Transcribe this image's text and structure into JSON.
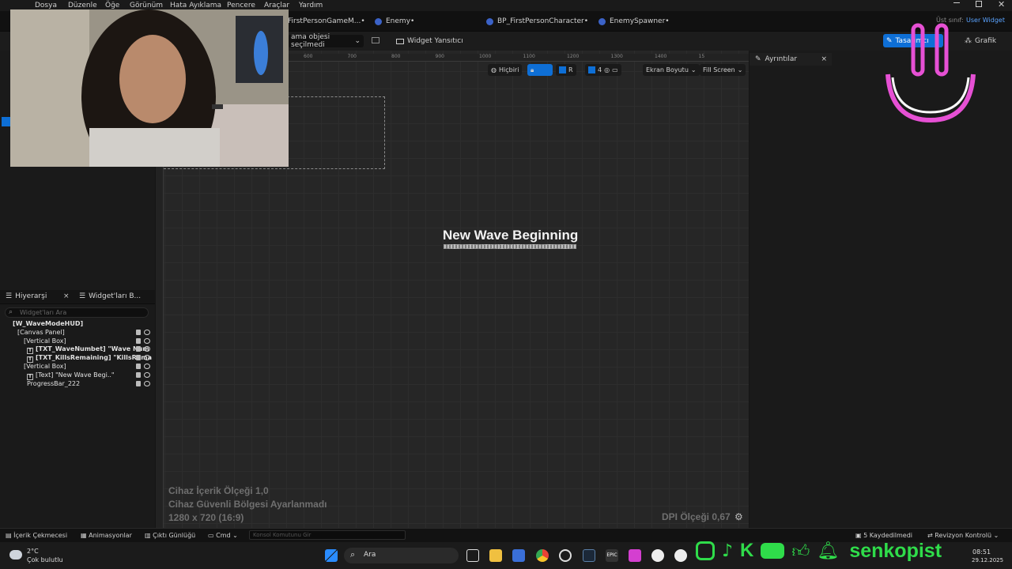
{
  "menubar": {
    "items": [
      "Dosya",
      "Düzenle",
      "Öğe",
      "Görünüm",
      "Hata Ayıklama",
      "Pencere",
      "Araçlar",
      "Yardım"
    ]
  },
  "tabs": {
    "items": [
      "FirstPersonGameM...•",
      "Enemy•",
      "BP_FirstPersonCharacter•",
      "EnemySpawner•"
    ],
    "parent_class_label": "Üst sınıf:",
    "parent_class_value": "User Widget"
  },
  "toolbar": {
    "debug_object": "ama objesi seçilmedi",
    "widget_reflector": "Widget Yansıtıcı",
    "designer_label": "Tasarımcı",
    "graph_label": "Grafik"
  },
  "ruler": {
    "top_ticks": [
      "600",
      "700",
      "800",
      "900",
      "1000",
      "1100",
      "1200",
      "1300",
      "1400",
      "15"
    ]
  },
  "viewport_controls": {
    "none_label": "Hiçbiri",
    "r_label": "R",
    "grid_value": "4",
    "screen_size": "Ekran Boyutu",
    "fill_screen": "Fill Screen"
  },
  "canvas": {
    "wave_text": "New Wave Beginning",
    "progress_percent": 100,
    "info_lines": [
      "Cihaz İçerik Ölçeği 1,0",
      "Cihaz Güvenli Bölgesi Ayarlanmadı",
      "1280 x 720 (16:9)"
    ],
    "dpi_label": "DPI Ölçeği 0,67"
  },
  "hierarchy": {
    "tab_label": "Hiyerarşi",
    "library_tab_label": "Widget'ları B...",
    "search_placeholder": "Widget'ları Ara",
    "rows": [
      {
        "label": "[W_WaveModeHUD]",
        "indent": 0
      },
      {
        "label": "[Canvas Panel]",
        "indent": 1
      },
      {
        "label": "[Vertical Box]",
        "indent": 2
      },
      {
        "label": "[TXT_WaveNumbet] \"Wave Num",
        "indent": 3
      },
      {
        "label": "[TXT_KillsRemaining] \"KillsRema",
        "indent": 3
      },
      {
        "label": "[Vertical Box]",
        "indent": 2
      },
      {
        "label": "[Text] \"New Wave Begi..\"",
        "indent": 3
      },
      {
        "label": "ProgressBar_222",
        "indent": 3
      }
    ]
  },
  "details": {
    "tab_label": "Ayrıntılar"
  },
  "statusbar": {
    "content_drawer": "İçerik Çekmecesi",
    "animations": "Animasyonlar",
    "output_log": "Çıktı Günlüğü",
    "cmd": "Cmd",
    "console_placeholder": "Konsol Komutunu Gir",
    "saved": "5 Kaydedilmedi",
    "revision": "Revizyon Kontrolü"
  },
  "taskbar": {
    "weather_temp": "2°C",
    "weather_desc": "Çok bulutlu",
    "search_label": "Ara",
    "time": "08:51",
    "date": "29.12.2025"
  },
  "overlay": {
    "brand_name": "senkopist"
  },
  "colors": {
    "accent": "#0e6fd6",
    "brand_green": "#2fdc4a",
    "logo_pink": "#e650d4"
  }
}
